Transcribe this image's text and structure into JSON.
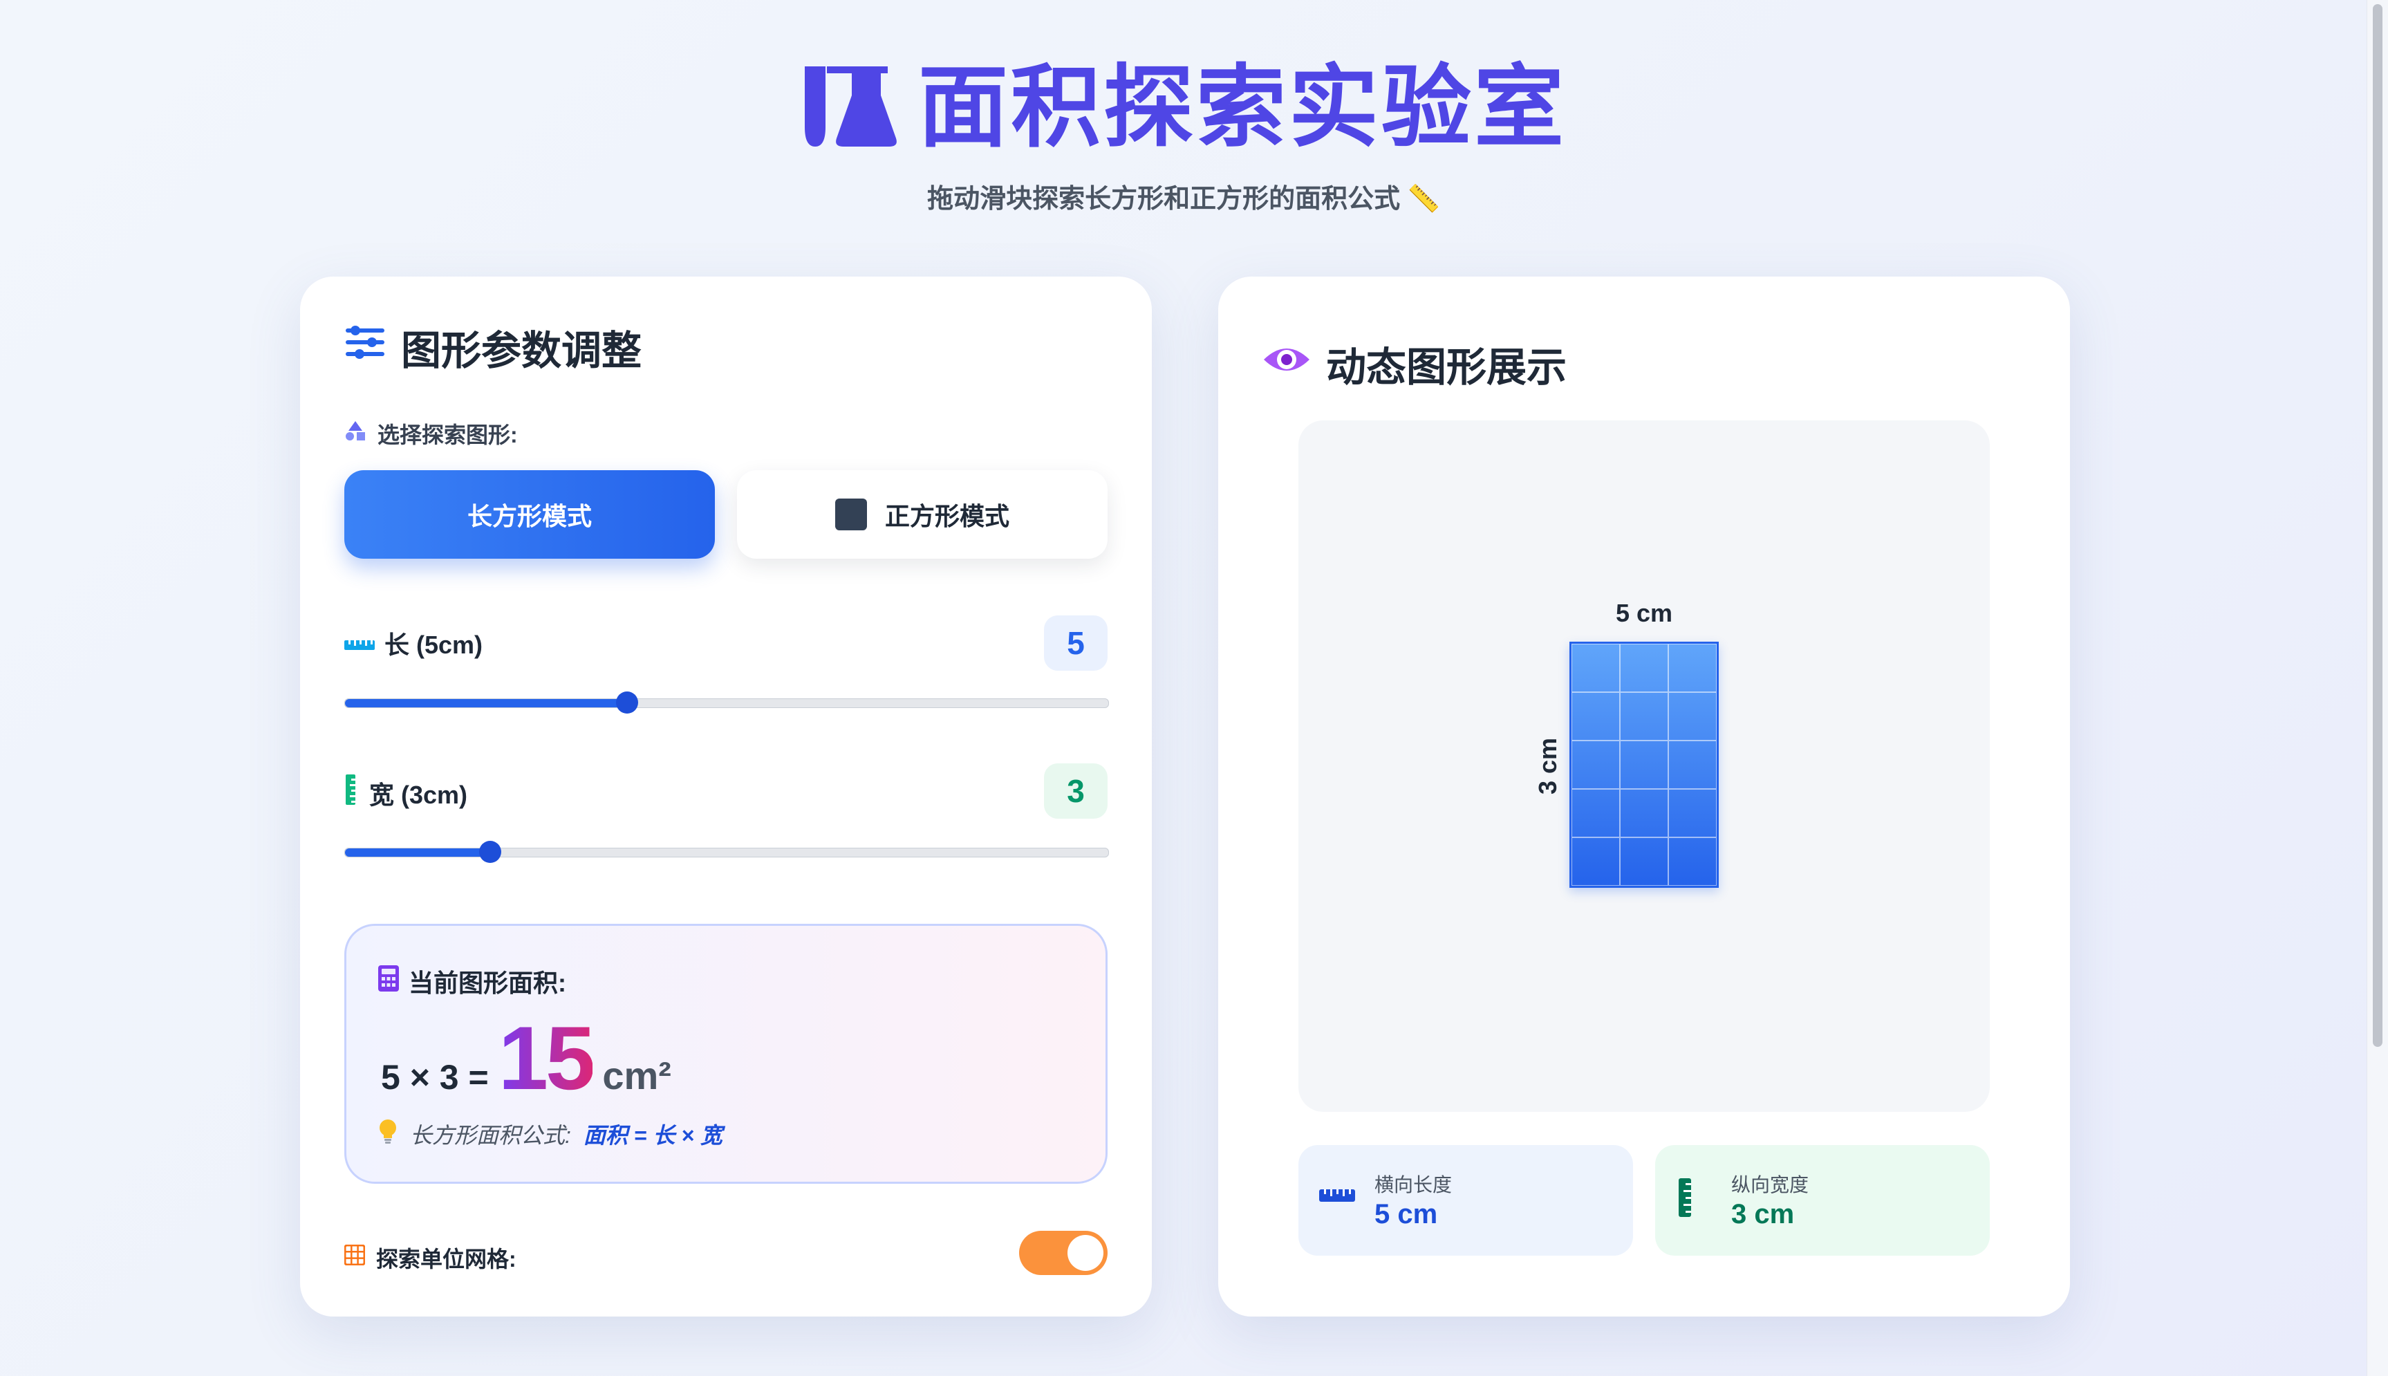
{
  "header": {
    "title": "面积探索实验室",
    "subtitle": "拖动滑块探索长方形和正方形的面积公式 📏"
  },
  "controls": {
    "card_title": "图形参数调整",
    "shape_select_label": "选择探索图形:",
    "modes": [
      {
        "label": "长方形模式",
        "active": true
      },
      {
        "label": "正方形模式",
        "active": false
      }
    ],
    "length": {
      "label": "长 (5cm)",
      "value": "5",
      "fraction": 0.37
    },
    "width": {
      "label": "宽 (3cm)",
      "value": "3",
      "fraction": 0.19
    },
    "area": {
      "title": "当前图形面积:",
      "formula": "5 × 3 =",
      "value": "15",
      "unit": "cm²",
      "hint_prefix": "长方形面积公式:",
      "hint_formula": "面积 = 长 × 宽"
    },
    "grid_toggle": {
      "label": "探索单位网格:",
      "on": true
    }
  },
  "display": {
    "card_title": "动态图形展示",
    "top_dimension": "5 cm",
    "side_dimension": "3 cm",
    "grid": {
      "columns": 3,
      "rows": 5
    },
    "info": [
      {
        "label": "横向长度",
        "value": "5 cm"
      },
      {
        "label": "纵向宽度",
        "value": "3 cm"
      }
    ]
  },
  "colors": {
    "accent": "#4f46e5",
    "primary_blue": "#2563eb",
    "green": "#059669",
    "toggle_orange": "#fb923c"
  },
  "icons": {
    "title": "flask-icon",
    "controls": "sliders-icon",
    "shape_select": "shapes-icon",
    "length": "ruler-horizontal-icon",
    "width": "ruler-vertical-icon",
    "area": "calculator-icon",
    "hint": "lightbulb-icon",
    "grid": "grid-icon",
    "display": "eye-icon"
  }
}
